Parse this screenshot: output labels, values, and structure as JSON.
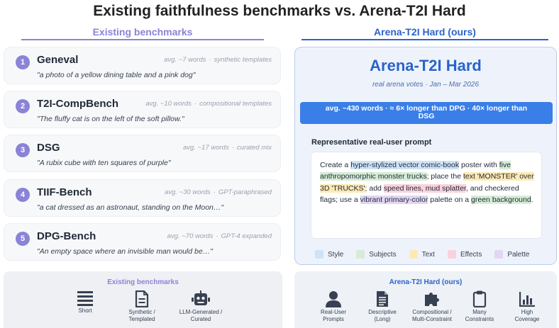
{
  "title": "Existing faithfulness benchmarks vs. Arena-T2I Hard",
  "left_header": "Existing benchmarks",
  "right_header": "Arena-T2I Hard (ours)",
  "benchmarks": [
    {
      "num": "1",
      "name": "Geneval",
      "words": "avg. ~7 words",
      "source": "synthetic templates",
      "quote": "\"a photo of a yellow dining table and a pink dog\""
    },
    {
      "num": "2",
      "name": "T2I-CompBench",
      "words": "avg. ~10 words",
      "source": "compositional templates",
      "quote": "\"The fluffy cat is on the left of the soft pillow.\""
    },
    {
      "num": "3",
      "name": "DSG",
      "words": "avg. ~17 words",
      "source": "curated mix",
      "quote": "\"A rubix cube with ten squares of purple\""
    },
    {
      "num": "4",
      "name": "TIIF-Bench",
      "words": "avg. ~30 words",
      "source": "GPT-paraphrased",
      "quote": "\"a cat dressed as an astronaut, standing on the Moon…\""
    },
    {
      "num": "5",
      "name": "DPG-Bench",
      "words": "avg. ~70 words",
      "source": "GPT-4 expanded",
      "quote": "\"An empty space where an invisible man would be…\""
    }
  ],
  "separator": "·",
  "arena": {
    "title": "Arena-T2I Hard",
    "subtitle": "real arena votes · Jan – Mar 2026",
    "stats_line1": "avg. ~430 words  ·  ≈ 6× longer than DPG  ·  40× longer than",
    "stats_line2": "DSG",
    "rep_label": "Representative real-user prompt",
    "prompt": {
      "p1": "Create a ",
      "h1": "hyper-stylized vector comic-book",
      "p2": " poster with ",
      "h2": "five anthropomorphic monster trucks",
      "p3": "; place the ",
      "h3": "text 'MONSTER' over 3D 'TRUCKS'",
      "p4": "; add ",
      "h4": "speed lines, mud splatter",
      "p5": ", and checkered flags; use a ",
      "h5": "vibrant primary-color",
      "p6": " palette on a ",
      "h6": "green background",
      "p7": "."
    },
    "legend": [
      {
        "label": "Style",
        "color": "#cfe2f6"
      },
      {
        "label": "Subjects",
        "color": "#d6ecd6"
      },
      {
        "label": "Text",
        "color": "#fde9b4"
      },
      {
        "label": "Effects",
        "color": "#f9d2dc"
      },
      {
        "label": "Palette",
        "color": "#e2d6f3"
      }
    ]
  },
  "summary_left": {
    "title": "Existing benchmarks",
    "items": [
      {
        "icon": "menu-lines-icon",
        "line1": "Short",
        "line2": ""
      },
      {
        "icon": "document-icon",
        "line1": "Synthetic /",
        "line2": "Templated"
      },
      {
        "icon": "robot-icon",
        "line1": "LLM-Generated /",
        "line2": "Curated"
      }
    ]
  },
  "summary_right": {
    "title": "Arena-T2I Hard (ours)",
    "items": [
      {
        "icon": "user-icon",
        "line1": "Real-User",
        "line2": "Prompts"
      },
      {
        "icon": "long-document-icon",
        "line1": "Descriptive",
        "line2": "(Long)"
      },
      {
        "icon": "puzzle-icon",
        "line1": "Compositional /",
        "line2": "Multi-Constraint"
      },
      {
        "icon": "clipboard-icon",
        "line1": "Many",
        "line2": "Constraints"
      },
      {
        "icon": "bar-chart-icon",
        "line1": "High",
        "line2": "Coverage"
      }
    ]
  },
  "colors": {
    "accent_left": "#8a83d6",
    "accent_right": "#2b63c9",
    "pill": "#3a7ee8"
  }
}
